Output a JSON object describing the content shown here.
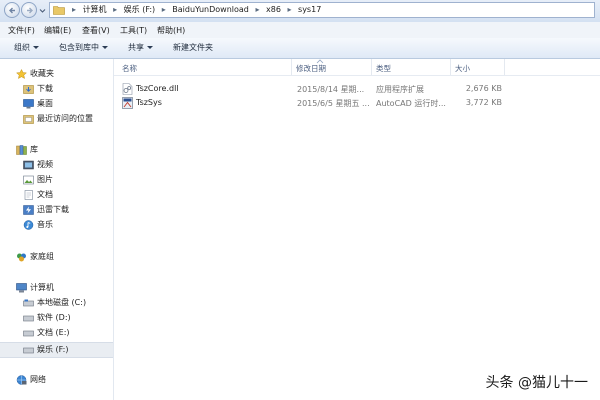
{
  "address": {
    "crumbs": [
      "计算机",
      "娱乐 (F:)",
      "BaiduYunDownload",
      "x86",
      "sys17"
    ]
  },
  "menu": [
    "文件(F)",
    "编辑(E)",
    "查看(V)",
    "工具(T)",
    "帮助(H)"
  ],
  "toolbar": {
    "organize": "组织",
    "include_in_library": "包含到库中",
    "share": "共享",
    "new_folder": "新建文件夹"
  },
  "sidebar": {
    "favorites": "收藏夹",
    "downloads": "下载",
    "desktop": "桌面",
    "recent": "最近访问的位置",
    "libraries": "库",
    "videos": "视频",
    "pictures": "图片",
    "documents": "文档",
    "thunder": "迅雷下载",
    "music": "音乐",
    "homegroup": "家庭组",
    "computer": "计算机",
    "drive_c": "本地磁盘 (C:)",
    "drive_d": "软件 (D:)",
    "drive_e": "文档 (E:)",
    "drive_f": "娱乐 (F:)",
    "network": "网络"
  },
  "columns": {
    "name": "名称",
    "modified": "修改日期",
    "type": "类型",
    "size": "大小"
  },
  "files": [
    {
      "name": "TszCore.dll",
      "modified": "2015/8/14 星期...",
      "type": "应用程序扩展",
      "size": "2,676 KB",
      "icon": "dll-file-icon"
    },
    {
      "name": "TszSys",
      "modified": "2015/6/5 星期五 ...",
      "type": "AutoCAD 运行时...",
      "size": "3,772 KB",
      "icon": "autocad-file-icon"
    }
  ],
  "watermark": "头条 @猫儿十一"
}
